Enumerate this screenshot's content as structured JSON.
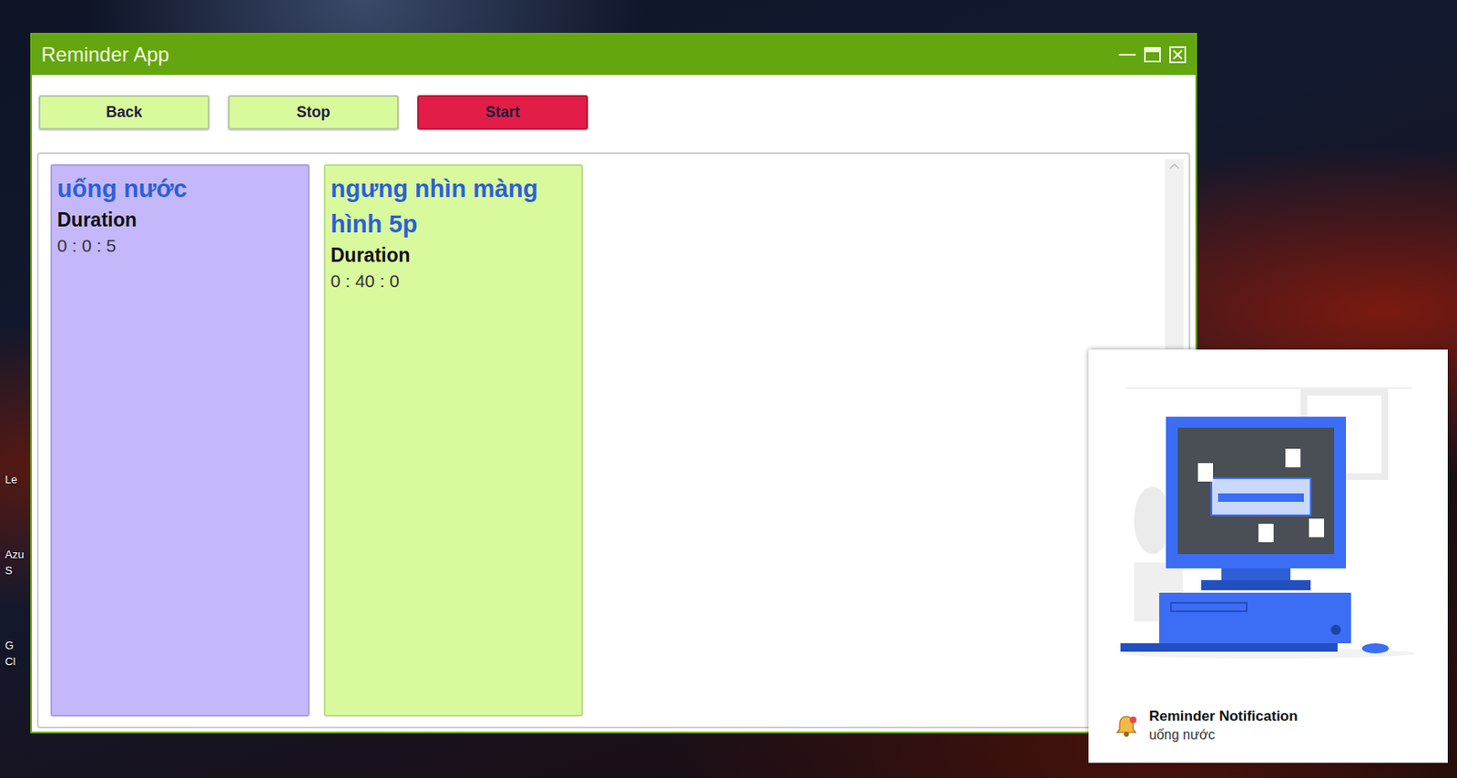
{
  "window": {
    "title": "Reminder App"
  },
  "toolbar": {
    "buttons": [
      {
        "label": "Back",
        "selected": false
      },
      {
        "label": "Stop",
        "selected": false
      },
      {
        "label": "Start",
        "selected": true
      }
    ]
  },
  "reminders": [
    {
      "title": "uống nước",
      "duration_label": "Duration",
      "duration": "0 : 0 : 5",
      "color": "#c4b8fb"
    },
    {
      "title": "ngưng nhìn màng hình 5p",
      "duration_label": "Duration",
      "duration": "0 : 40 : 0",
      "color": "#d9f99d"
    }
  ],
  "notification": {
    "title": "Reminder Notification",
    "message": "uống nước"
  },
  "desktop_icons": [
    {
      "lines": [
        "Le"
      ]
    },
    {
      "lines": [
        "Azu",
        "S"
      ]
    },
    {
      "lines": [
        "G",
        "Cl"
      ]
    }
  ]
}
